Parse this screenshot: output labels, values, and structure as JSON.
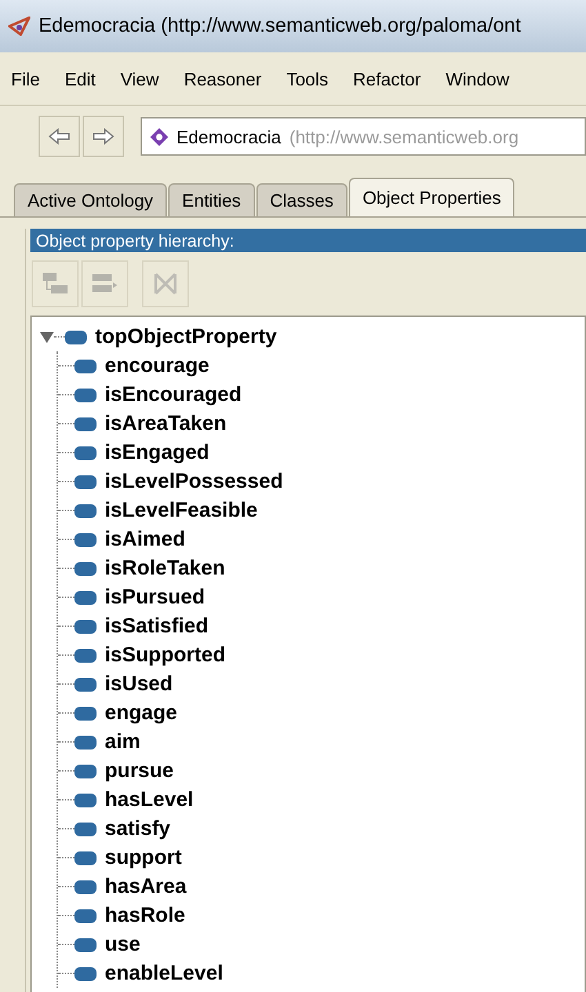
{
  "window": {
    "title": "Edemocracia (http://www.semanticweb.org/paloma/ont"
  },
  "menu": [
    "File",
    "Edit",
    "View",
    "Reasoner",
    "Tools",
    "Refactor",
    "Window"
  ],
  "address": {
    "name": "Edemocracia",
    "iri": "(http://www.semanticweb.org"
  },
  "tabs": [
    {
      "label": "Active Ontology",
      "selected": false
    },
    {
      "label": "Entities",
      "selected": false
    },
    {
      "label": "Classes",
      "selected": false
    },
    {
      "label": "Object Properties",
      "selected": true
    }
  ],
  "panel": {
    "title": "Object property hierarchy:",
    "tools": [
      {
        "kind": "add-sub",
        "disabled": true
      },
      {
        "kind": "add-sibling",
        "disabled": true
      },
      {
        "kind": "delete",
        "disabled": true
      }
    ]
  },
  "tree": [
    {
      "label": "topObjectProperty",
      "expanded": true,
      "children": [
        {
          "label": "encourage"
        },
        {
          "label": "isEncouraged"
        },
        {
          "label": "isAreaTaken"
        },
        {
          "label": "isEngaged"
        },
        {
          "label": "isLevelPossessed"
        },
        {
          "label": "isLevelFeasible"
        },
        {
          "label": "isAimed"
        },
        {
          "label": "isRoleTaken"
        },
        {
          "label": "isPursued"
        },
        {
          "label": "isSatisfied"
        },
        {
          "label": "isSupported"
        },
        {
          "label": "isUsed"
        },
        {
          "label": "engage"
        },
        {
          "label": "aim"
        },
        {
          "label": "pursue"
        },
        {
          "label": "hasLevel"
        },
        {
          "label": "satisfy"
        },
        {
          "label": "support"
        },
        {
          "label": "hasArea"
        },
        {
          "label": "hasRole"
        },
        {
          "label": "use"
        },
        {
          "label": "enableLevel"
        }
      ]
    }
  ]
}
